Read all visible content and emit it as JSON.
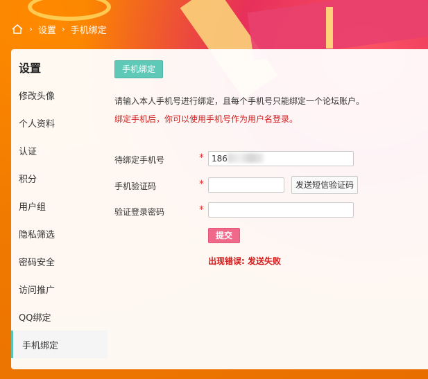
{
  "breadcrumb": {
    "home_icon": "home-icon",
    "items": [
      "设置",
      "手机绑定"
    ]
  },
  "sidebar": {
    "title": "设置",
    "items": [
      {
        "label": "修改头像"
      },
      {
        "label": "个人资料"
      },
      {
        "label": "认证"
      },
      {
        "label": "积分"
      },
      {
        "label": "用户组"
      },
      {
        "label": "隐私筛选"
      },
      {
        "label": "密码安全"
      },
      {
        "label": "访问推广"
      },
      {
        "label": "QQ绑定"
      },
      {
        "label": "手机绑定",
        "active": true
      }
    ]
  },
  "main": {
    "tab_label": "手机绑定",
    "intro": "请输入本人手机号进行绑定，且每个手机号只能绑定一个论坛账户。",
    "warning": "绑定手机后，你可以使用手机号作为用户名登录。",
    "form": {
      "phone_label": "待绑定手机号",
      "phone_value": "186",
      "code_label": "手机验证码",
      "code_value": "",
      "send_sms_label": "发送短信验证码",
      "password_label": "验证登录密码",
      "password_value": "",
      "required_mark": "*",
      "submit_label": "提交",
      "error_text": "出现错误: 发送失败"
    }
  },
  "colors": {
    "tab_accent": "#5fc9b7",
    "submit": "#f0688a",
    "error": "#d11a1a"
  }
}
